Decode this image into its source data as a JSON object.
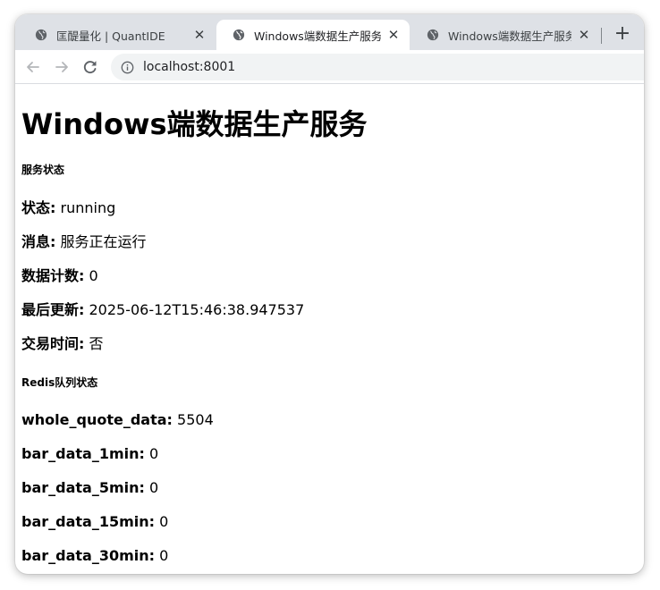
{
  "browser": {
    "tabs": [
      {
        "title": "匡醍量化 | QuantIDE",
        "active": false,
        "icon": "globe-icon"
      },
      {
        "title": "Windows端数据生产服务",
        "active": true,
        "icon": "globe-icon"
      },
      {
        "title": "Windows端数据生产服务 - ",
        "active": false,
        "icon": "globe-icon"
      }
    ],
    "tab_close_glyph": "✕",
    "new_tab_glyph": "+",
    "address": "localhost:8001"
  },
  "page": {
    "title": "Windows端数据生产服务",
    "service_section": {
      "heading": "服务状态",
      "rows": [
        {
          "label": "状态:",
          "value": " running"
        },
        {
          "label": "消息:",
          "value": " 服务正在运行"
        },
        {
          "label": "数据计数:",
          "value": " 0"
        },
        {
          "label": "最后更新:",
          "value": " 2025-06-12T15:46:38.947537"
        },
        {
          "label": "交易时间:",
          "value": " 否"
        }
      ]
    },
    "redis_section": {
      "heading": "Redis队列状态",
      "rows": [
        {
          "label": "whole_quote_data:",
          "value": " 5504"
        },
        {
          "label": "bar_data_1min:",
          "value": " 0"
        },
        {
          "label": "bar_data_5min:",
          "value": " 0"
        },
        {
          "label": "bar_data_15min:",
          "value": " 0"
        },
        {
          "label": "bar_data_30min:",
          "value": " 0"
        }
      ]
    }
  },
  "colors": {
    "tabstrip_bg": "#dee1e6",
    "omnibox_bg": "#f1f3f4",
    "icon_gray": "#5f6368"
  }
}
